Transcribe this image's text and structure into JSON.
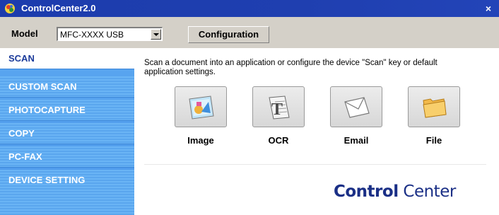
{
  "window": {
    "title": "ControlCenter2.0",
    "close_label": "×"
  },
  "toolbar": {
    "model_label": "Model",
    "model_value": "MFC-XXXX USB",
    "configuration_label": "Configuration"
  },
  "sidebar": {
    "items": [
      {
        "label": "SCAN",
        "active": true
      },
      {
        "label": "CUSTOM SCAN",
        "active": false
      },
      {
        "label": "PHOTOCAPTURE",
        "active": false
      },
      {
        "label": "COPY",
        "active": false
      },
      {
        "label": "PC-FAX",
        "active": false
      },
      {
        "label": "DEVICE SETTING",
        "active": false
      }
    ]
  },
  "main": {
    "description": "Scan a document into an application or configure the device \"Scan\" key or default application settings.",
    "buttons": [
      {
        "label": "Image",
        "icon": "image-icon"
      },
      {
        "label": "OCR",
        "icon": "ocr-icon"
      },
      {
        "label": "Email",
        "icon": "email-icon"
      },
      {
        "label": "File",
        "icon": "folder-icon"
      }
    ],
    "brand_bold": "Control",
    "brand_light": "Center"
  },
  "colors": {
    "titlebar": "#1f3fb0",
    "sidebar": "#5aa6ee",
    "brand": "#1a2f86"
  }
}
